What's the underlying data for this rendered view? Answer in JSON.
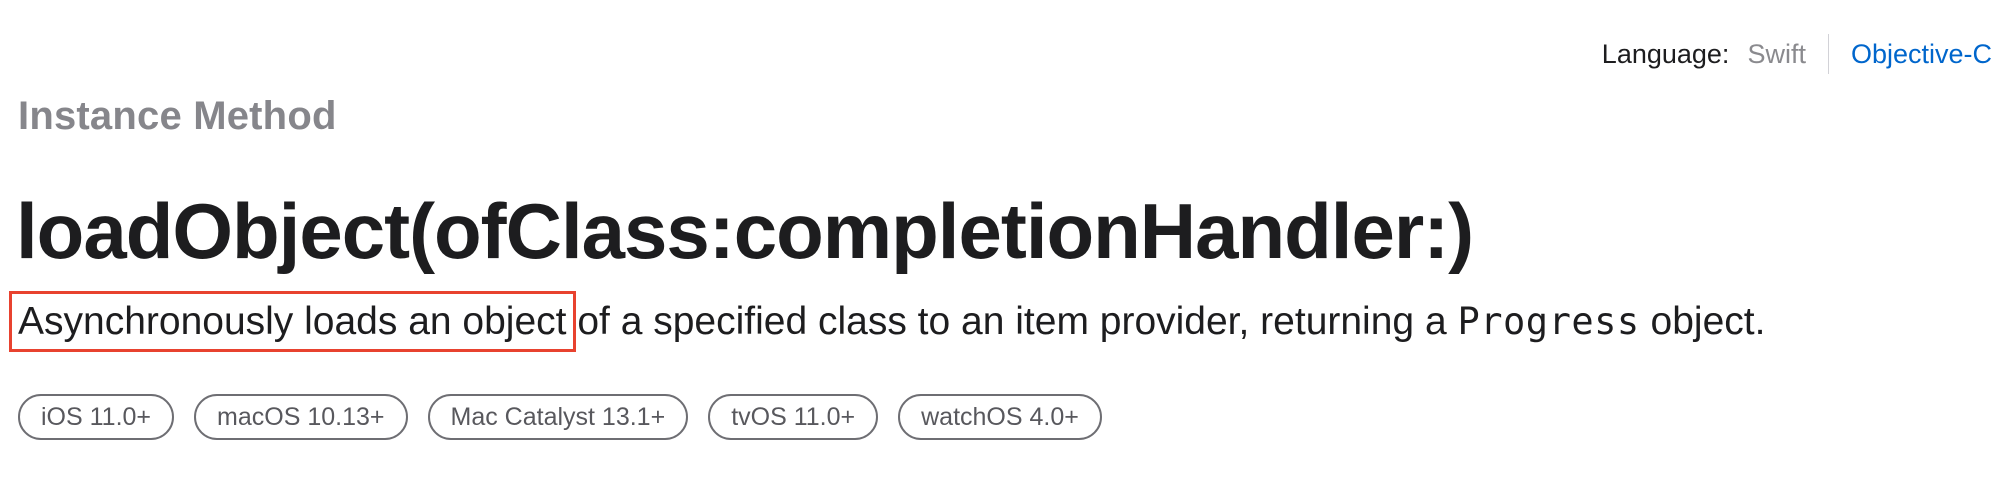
{
  "language_switcher": {
    "label": "Language:",
    "options": [
      {
        "label": "Swift",
        "active": false
      },
      {
        "label": "Objective-C",
        "active": true
      }
    ],
    "active_color": "#0066cc",
    "inactive_color": "#8a8a8e"
  },
  "eyebrow": "Instance Method",
  "title": "loadObject(ofClass:completionHandler:)",
  "abstract": {
    "highlighted": "Asynchronously loads an object",
    "text_before_code": " of a specified class to an item provider, returning a ",
    "code": "Progress",
    "text_after_code": " object.",
    "highlight_color": "#e8422f"
  },
  "availability": [
    "iOS 11.0+",
    "macOS 10.13+",
    "Mac Catalyst 13.1+",
    "tvOS 11.0+",
    "watchOS 4.0+"
  ]
}
